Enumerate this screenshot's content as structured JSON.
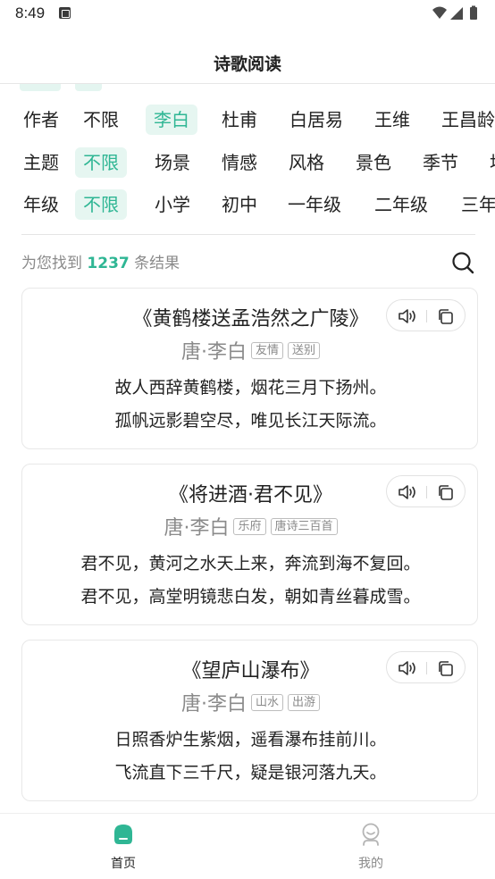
{
  "status_bar": {
    "time": "8:49"
  },
  "header": {
    "title": "诗歌阅读"
  },
  "filters": {
    "author": {
      "label": "作者",
      "options": [
        "不限",
        "李白",
        "杜甫",
        "白居易",
        "王维",
        "王昌龄"
      ],
      "selected": "李白"
    },
    "theme": {
      "label": "主题",
      "options": [
        "不限",
        "场景",
        "情感",
        "风格",
        "景色",
        "季节",
        "地"
      ],
      "selected": "不限"
    },
    "grade": {
      "label": "年级",
      "options": [
        "不限",
        "小学",
        "初中",
        "一年级",
        "二年级",
        "三年级"
      ],
      "selected": "不限"
    }
  },
  "results": {
    "prefix": "为您找到",
    "count": "1237",
    "suffix": "条结果"
  },
  "poems": [
    {
      "title": "《黄鹤楼送孟浩然之广陵》",
      "author": "唐·李白",
      "tags": [
        "友情",
        "送别"
      ],
      "lines": [
        "故人西辞黄鹤楼，烟花三月下扬州。",
        "孤帆远影碧空尽，唯见长江天际流。"
      ]
    },
    {
      "title": "《将进酒·君不见》",
      "author": "唐·李白",
      "tags": [
        "乐府",
        "唐诗三百首"
      ],
      "lines": [
        "君不见，黄河之水天上来，奔流到海不复回。",
        "君不见，高堂明镜悲白发，朝如青丝暮成雪。"
      ]
    },
    {
      "title": "《望庐山瀑布》",
      "author": "唐·李白",
      "tags": [
        "山水",
        "出游"
      ],
      "lines": [
        "日照香炉生紫烟，遥看瀑布挂前川。",
        "飞流直下三千尺，疑是银河落九天。"
      ]
    }
  ],
  "bottom_nav": [
    {
      "label": "首页",
      "active": true,
      "icon": "home-icon"
    },
    {
      "label": "我的",
      "active": false,
      "icon": "profile-icon"
    }
  ],
  "colors": {
    "accent": "#2fb694",
    "accent_light": "#e6f6f1",
    "muted": "#8a8a8a"
  }
}
